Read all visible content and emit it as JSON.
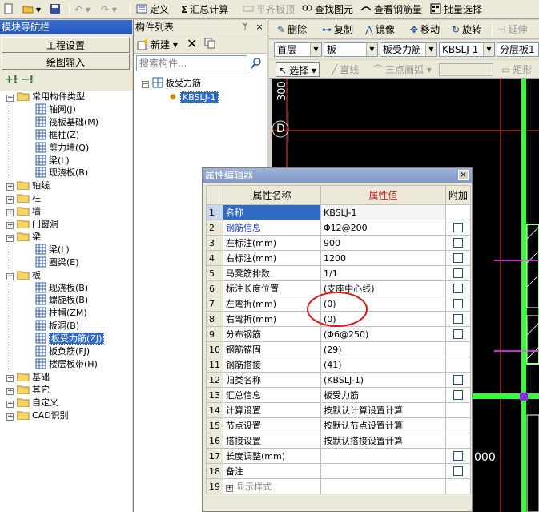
{
  "top_toolbar": {
    "define": "定义",
    "sum_calc": "汇总计算",
    "flush_slab_top": "平齐板顶",
    "find_element": "查找图元",
    "view_rebar": "查看钢筋量",
    "batch_select": "批量选择"
  },
  "module_nav": {
    "title": "模块导航栏",
    "project_settings": "工程设置",
    "drawing_input": "绘图输入",
    "tree": [
      {
        "label": "常用构件类型",
        "level": 0,
        "expanded": true
      },
      {
        "label": "轴网(J)",
        "level": 1
      },
      {
        "label": "筏板基础(M)",
        "level": 1
      },
      {
        "label": "框柱(Z)",
        "level": 1
      },
      {
        "label": "剪力墙(Q)",
        "level": 1
      },
      {
        "label": "梁(L)",
        "level": 1
      },
      {
        "label": "现浇板(B)",
        "level": 1
      },
      {
        "label": "轴线",
        "level": 0,
        "expanded": false
      },
      {
        "label": "柱",
        "level": 0,
        "expanded": false
      },
      {
        "label": "墙",
        "level": 0,
        "expanded": false
      },
      {
        "label": "门窗洞",
        "level": 0,
        "expanded": false
      },
      {
        "label": "梁",
        "level": 0,
        "expanded": true
      },
      {
        "label": "梁(L)",
        "level": 1
      },
      {
        "label": "圈梁(E)",
        "level": 1
      },
      {
        "label": "板",
        "level": 0,
        "expanded": true
      },
      {
        "label": "现浇板(B)",
        "level": 1
      },
      {
        "label": "螺旋板(B)",
        "level": 1
      },
      {
        "label": "柱帽(ZM)",
        "level": 1
      },
      {
        "label": "板洞(B)",
        "level": 1
      },
      {
        "label": "板受力筋(ZJ)",
        "level": 1,
        "selected": true
      },
      {
        "label": "板负筋(FJ)",
        "level": 1
      },
      {
        "label": "楼层板带(H)",
        "level": 1
      },
      {
        "label": "基础",
        "level": 0,
        "expanded": false
      },
      {
        "label": "其它",
        "level": 0,
        "expanded": false
      },
      {
        "label": "自定义",
        "level": 0,
        "expanded": false
      },
      {
        "label": "CAD识别",
        "level": 0,
        "expanded": false
      }
    ]
  },
  "component_list": {
    "title": "构件列表",
    "new_label": "新建",
    "search_placeholder": "搜索构件...",
    "root": "板受力筋",
    "child": "KBSLJ-1"
  },
  "edit_toolbar": {
    "delete": "删除",
    "copy": "复制",
    "mirror": "镜像",
    "move": "移动",
    "rotate": "旋转",
    "extend": "延伸"
  },
  "selectors": {
    "floor": "首层",
    "category": "板",
    "type": "板受力筋",
    "component": "KBSLJ-1",
    "layer": "分层板1"
  },
  "draw_toolbar": {
    "select": "选择",
    "line": "直线",
    "three_point_arc": "三点画弧",
    "rectangle": "矩形"
  },
  "canvas": {
    "axis_label": "D",
    "dim_top": "300",
    "dim_right": "000"
  },
  "property_editor": {
    "title": "属性编辑器",
    "col_name": "属性名称",
    "col_value": "属性值",
    "col_extra": "附加",
    "rows": [
      {
        "no": "1",
        "name": "名称",
        "value": "KBSLJ-1",
        "blue": true,
        "checkbox": false
      },
      {
        "no": "2",
        "name": "钢筋信息",
        "value": "Φ12@200",
        "blue": true,
        "checkbox": true
      },
      {
        "no": "3",
        "name": "左标注(mm)",
        "value": "900",
        "blue": false,
        "checkbox": true
      },
      {
        "no": "4",
        "name": "右标注(mm)",
        "value": "1200",
        "blue": false,
        "checkbox": true
      },
      {
        "no": "5",
        "name": "马凳筋排数",
        "value": "1/1",
        "blue": false,
        "checkbox": true
      },
      {
        "no": "6",
        "name": "标注长度位置",
        "value": "(支座中心线)",
        "blue": false,
        "checkbox": true
      },
      {
        "no": "7",
        "name": "左弯折(mm)",
        "value": "(0)",
        "blue": false,
        "checkbox": true
      },
      {
        "no": "8",
        "name": "右弯折(mm)",
        "value": "(0)",
        "blue": false,
        "checkbox": true
      },
      {
        "no": "9",
        "name": "分布钢筋",
        "value": "(Φ6@250)",
        "blue": false,
        "checkbox": true
      },
      {
        "no": "10",
        "name": "钢筋锚固",
        "value": "(29)",
        "blue": false,
        "checkbox": false
      },
      {
        "no": "11",
        "name": "钢筋搭接",
        "value": "(41)",
        "blue": false,
        "checkbox": false
      },
      {
        "no": "12",
        "name": "归类名称",
        "value": "(KBSLJ-1)",
        "blue": false,
        "checkbox": true
      },
      {
        "no": "13",
        "name": "汇总信息",
        "value": "板受力筋",
        "blue": false,
        "checkbox": true
      },
      {
        "no": "14",
        "name": "计算设置",
        "value": "按默认计算设置计算",
        "blue": false,
        "checkbox": false
      },
      {
        "no": "15",
        "name": "节点设置",
        "value": "按默认节点设置计算",
        "blue": false,
        "checkbox": false
      },
      {
        "no": "16",
        "name": "搭接设置",
        "value": "按默认搭接设置计算",
        "blue": false,
        "checkbox": false
      },
      {
        "no": "17",
        "name": "长度调整(mm)",
        "value": "",
        "blue": false,
        "checkbox": true
      },
      {
        "no": "18",
        "name": "备注",
        "value": "",
        "blue": false,
        "checkbox": true
      },
      {
        "no": "19",
        "name": "显示样式",
        "value": "",
        "blue": false,
        "checkbox": false,
        "group": true
      }
    ]
  }
}
